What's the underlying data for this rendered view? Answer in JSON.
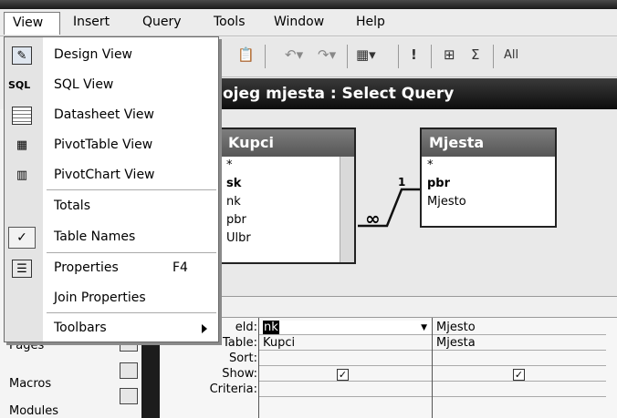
{
  "menubar": {
    "items": [
      "View",
      "Insert",
      "Query",
      "Tools",
      "Window",
      "Help"
    ]
  },
  "toolbar": {
    "all_label": "All"
  },
  "window": {
    "title": "ojeg mjesta : Select Query"
  },
  "view_menu": {
    "items": [
      {
        "label": "Design View",
        "icon": "design-view-icon"
      },
      {
        "label": "SQL View",
        "icon_text": "SQL"
      },
      {
        "label": "Datasheet View",
        "icon": "datasheet-icon"
      },
      {
        "label": "PivotTable View",
        "icon": "pivottable-icon"
      },
      {
        "label": "PivotChart View",
        "icon": "pivotchart-icon"
      },
      {
        "label": "Totals"
      },
      {
        "label": "Table Names",
        "checked": true
      },
      {
        "label": "Properties",
        "shortcut": "F4",
        "icon": "properties-icon"
      },
      {
        "label": "Join Properties"
      },
      {
        "label": "Toolbars",
        "submenu": true
      }
    ]
  },
  "tables": [
    {
      "name": "Kupci",
      "fields": [
        "*",
        "sk",
        "nk",
        "pbr",
        "Ulbr"
      ]
    },
    {
      "name": "Mjesta",
      "fields": [
        "*",
        "pbr",
        "Mjesto"
      ]
    }
  ],
  "relationship": {
    "one": "1",
    "many": "∞"
  },
  "objects": [
    "Pages",
    "Macros",
    "Modules"
  ],
  "grid": {
    "row_labels": [
      "eld:",
      "Table:",
      "Sort:",
      "Show:",
      "Criteria:"
    ],
    "columns": [
      {
        "field": "nk",
        "table": "Kupci",
        "show": true
      },
      {
        "field": "Mjesto",
        "table": "Mjesta",
        "show": true
      }
    ]
  }
}
